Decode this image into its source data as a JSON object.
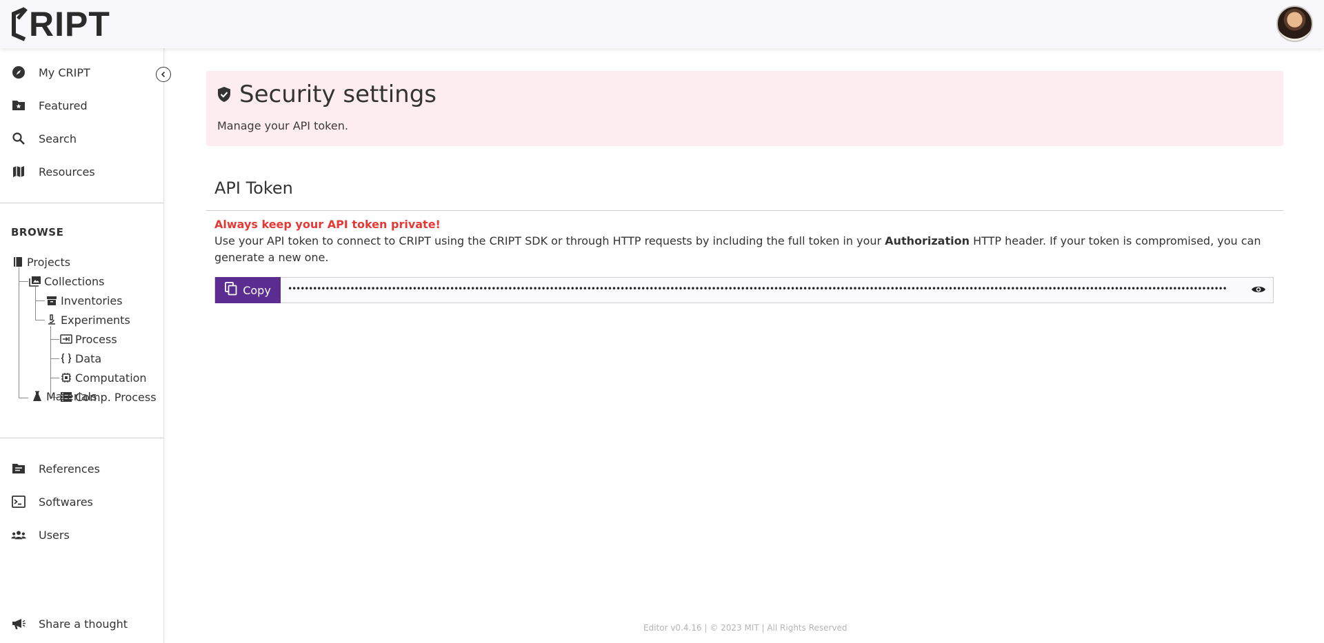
{
  "header": {
    "logo_text": "RIPT",
    "logo_icon": "cript-bracket-logo",
    "avatar_icon": "user-avatar"
  },
  "sidebar": {
    "collapse_icon": "chevron-left-icon",
    "top_items": [
      {
        "label": "My CRIPT",
        "icon": "compass-icon"
      },
      {
        "label": "Featured",
        "icon": "folder-star-icon"
      },
      {
        "label": "Search",
        "icon": "search-icon"
      },
      {
        "label": "Resources",
        "icon": "map-icon"
      }
    ],
    "browse_title": "BROWSE",
    "tree": [
      {
        "label": "Projects",
        "icon": "book-icon"
      },
      {
        "label": "Collections",
        "icon": "image-collection-icon"
      },
      {
        "label": "Inventories",
        "icon": "archive-icon"
      },
      {
        "label": "Experiments",
        "icon": "microscope-icon"
      },
      {
        "label": "Process",
        "icon": "process-input-icon"
      },
      {
        "label": "Data",
        "icon": "braces-icon"
      },
      {
        "label": "Computation",
        "icon": "chip-icon"
      },
      {
        "label": "Comp. Process",
        "icon": "storage-list-icon"
      },
      {
        "label": "Materials",
        "icon": "flask-icon"
      }
    ],
    "bottom_items": [
      {
        "label": "References",
        "icon": "folder-lines-icon"
      },
      {
        "label": "Softwares",
        "icon": "terminal-icon"
      },
      {
        "label": "Users",
        "icon": "users-icon"
      }
    ],
    "feedback": {
      "label": "Share a thought",
      "icon": "megaphone-icon"
    }
  },
  "banner": {
    "title": "Security settings",
    "subtitle": "Manage your API token.",
    "icon": "shield-check-icon"
  },
  "api_token": {
    "section_title": "API Token",
    "warning": "Always keep your API token private!",
    "desc_before": "Use your API token to connect to CRIPT using the CRIPT SDK or through HTTP requests by including the full token in your ",
    "desc_bold": "Authorization",
    "desc_after": " HTTP header. If your token is compromised, you can generate a new one.",
    "copy_label": "Copy",
    "copy_icon": "copy-icon",
    "token_masked": "••••••••••••••••••••••••••••••••••••••••••••••••••••••••••••••••••••••••••••••••••••••••••••••••••••••••••••••••••••••••••••••••••••••••••••••••••••••••••••••••••••••••••••••••••••••••••••••••••••••••••••••••••••••••••••••••••",
    "reveal_icon": "eye-icon"
  },
  "footer": {
    "text": "Editor v0.4.16 | © 2023 MIT | All Rights Reserved"
  }
}
